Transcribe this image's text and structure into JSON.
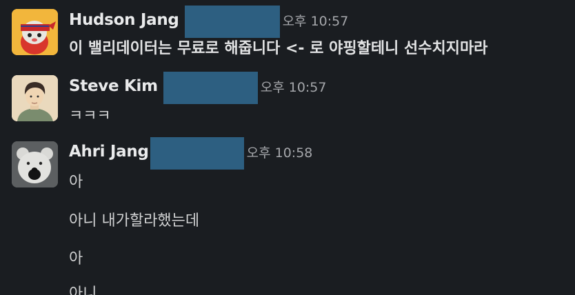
{
  "messages": [
    {
      "sender": "Hudson Jang",
      "time": "오후 10:57",
      "lines": [
        "이 밸리데이터는 무료로 해줍니다 <- 로 야핑할테니 선수치지마라"
      ],
      "avatar_icon": "red-bandana-cat-avatar"
    },
    {
      "sender": "Steve Kim",
      "time": "오후 10:57",
      "lines": [
        "ㅋㅋㅋ"
      ],
      "avatar_icon": "illustrated-man-avatar"
    },
    {
      "sender": "Ahri Jang",
      "time": "오후 10:58",
      "lines": [
        "아",
        "아니 내가할라했는데",
        "아",
        "아니"
      ],
      "avatar_icon": "polar-bear-avatar"
    }
  ],
  "colors": {
    "background": "#1a1d21",
    "redaction": "#2d5f81",
    "name": "#e9eaeb",
    "timestamp": "#a5a7ab"
  }
}
